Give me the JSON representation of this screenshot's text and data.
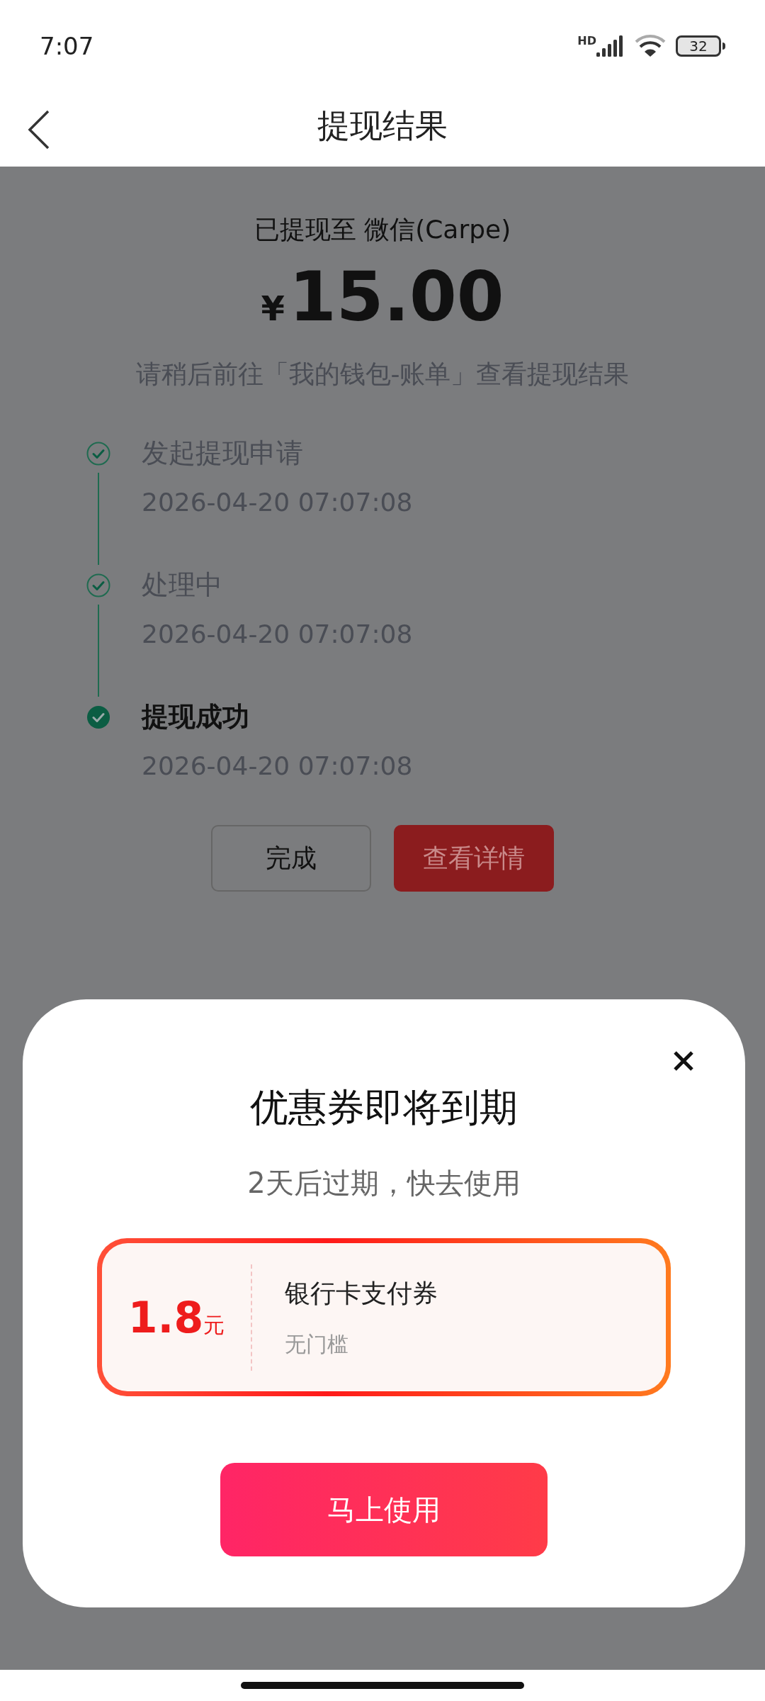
{
  "status_bar": {
    "time": "7:07",
    "network": "HD",
    "battery": "32"
  },
  "header": {
    "title": "提现结果"
  },
  "result": {
    "destination": "已提现至 微信(Carpe)",
    "currency": "¥",
    "amount": "15.00",
    "hint": "请稍后前往「我的钱包-账单」查看提现结果"
  },
  "steps": [
    {
      "title": "发起提现申请",
      "time": "2026-04-20 07:07:08",
      "current": false
    },
    {
      "title": "处理中",
      "time": "2026-04-20 07:07:08",
      "current": false
    },
    {
      "title": "提现成功",
      "time": "2026-04-20 07:07:08",
      "current": true
    }
  ],
  "buttons": [
    {
      "label": "完成",
      "kind": "outline"
    },
    {
      "label": "查看详情",
      "kind": "primary"
    }
  ],
  "dialog": {
    "title": "优惠券即将到期",
    "subtitle": "2天后过期，快去使用",
    "coupon": {
      "amount": "1.8",
      "unit": "元",
      "name": "银行卡支付券",
      "condition": "无门槛"
    },
    "action": "马上使用"
  }
}
